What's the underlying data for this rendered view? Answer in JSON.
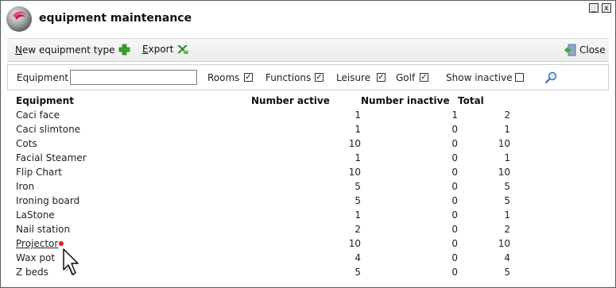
{
  "window": {
    "title": "equipment maintenance",
    "minimize": "_",
    "close": "x"
  },
  "toolbar": {
    "new_type": "New equipment type",
    "export": "Export",
    "close": "Close"
  },
  "filters": {
    "equipment_label": "Equipment",
    "equipment_value": "",
    "rooms_label": "Rooms",
    "rooms_checked": true,
    "functions_label": "Functions",
    "functions_checked": true,
    "leisure_label": "Leisure",
    "leisure_checked": true,
    "golf_label": "Golf",
    "golf_checked": true,
    "show_inactive_label": "Show inactive",
    "show_inactive_checked": false
  },
  "table": {
    "headers": [
      "Equipment",
      "Number active",
      "Number inactive",
      "Total"
    ],
    "rows": [
      [
        "Caci face",
        "1",
        "1",
        "2"
      ],
      [
        "Caci slimtone",
        "1",
        "0",
        "1"
      ],
      [
        "Cots",
        "10",
        "0",
        "10"
      ],
      [
        "Facial Steamer",
        "1",
        "0",
        "1"
      ],
      [
        "Flip Chart",
        "10",
        "0",
        "10"
      ],
      [
        "Iron",
        "5",
        "0",
        "5"
      ],
      [
        "Ironing board",
        "5",
        "0",
        "5"
      ],
      [
        "LaStone",
        "1",
        "0",
        "1"
      ],
      [
        "Nail station",
        "2",
        "0",
        "2"
      ],
      [
        "Projector",
        "10",
        "0",
        "10"
      ],
      [
        "Wax pot",
        "4",
        "0",
        "4"
      ],
      [
        "Z beds",
        "5",
        "0",
        "5"
      ]
    ]
  },
  "colors": {
    "link": "#1a35c9",
    "accent_green": "#3aa52a",
    "border": "#5a5a5a"
  },
  "icons": {
    "logo": "app-logo-icon",
    "new": "plus-icon",
    "export": "excel-icon",
    "close": "exit-door-icon",
    "search": "magnifier-icon"
  }
}
